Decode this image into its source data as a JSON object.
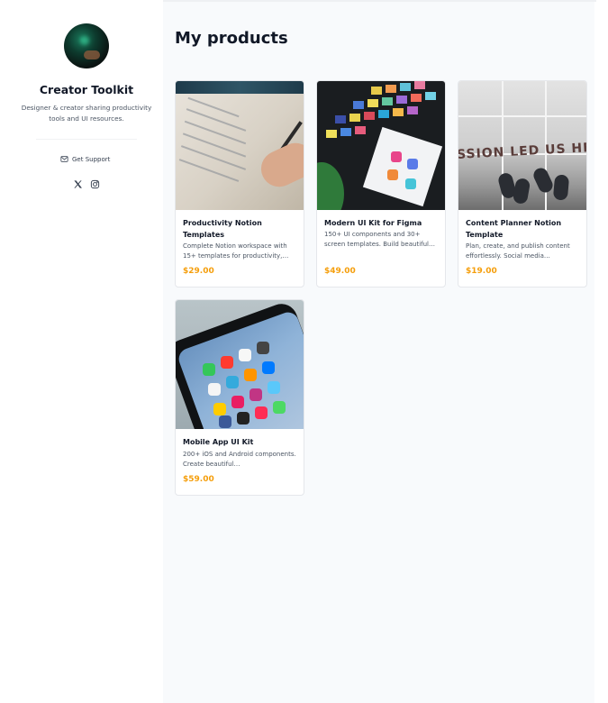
{
  "profile": {
    "name": "Creator Toolkit",
    "description": "Designer & creator sharing productivity tools and UI resources.",
    "support_label": "Get Support",
    "socials": [
      "x-icon",
      "instagram-icon"
    ]
  },
  "main": {
    "title": "My products",
    "products": [
      {
        "title": "Productivity Notion Templates",
        "description": "Complete Notion workspace with 15+ templates for productivity,…",
        "price": "$29.00"
      },
      {
        "title": "Modern UI Kit for Figma",
        "description": "150+ UI components and 30+ screen templates. Build beautiful…",
        "price": "$49.00"
      },
      {
        "title": "Content Planner Notion Template",
        "description": "Plan, create, and publish content effortlessly. Social media…",
        "price": "$19.00"
      },
      {
        "title": "Mobile App UI Kit",
        "description": "200+ iOS and Android components. Create beautiful…",
        "price": "$59.00"
      }
    ]
  },
  "thumb3_text": "SSION LED US HE",
  "colors": {
    "price": "#f59e0b",
    "main_bg": "#f8fafc"
  }
}
